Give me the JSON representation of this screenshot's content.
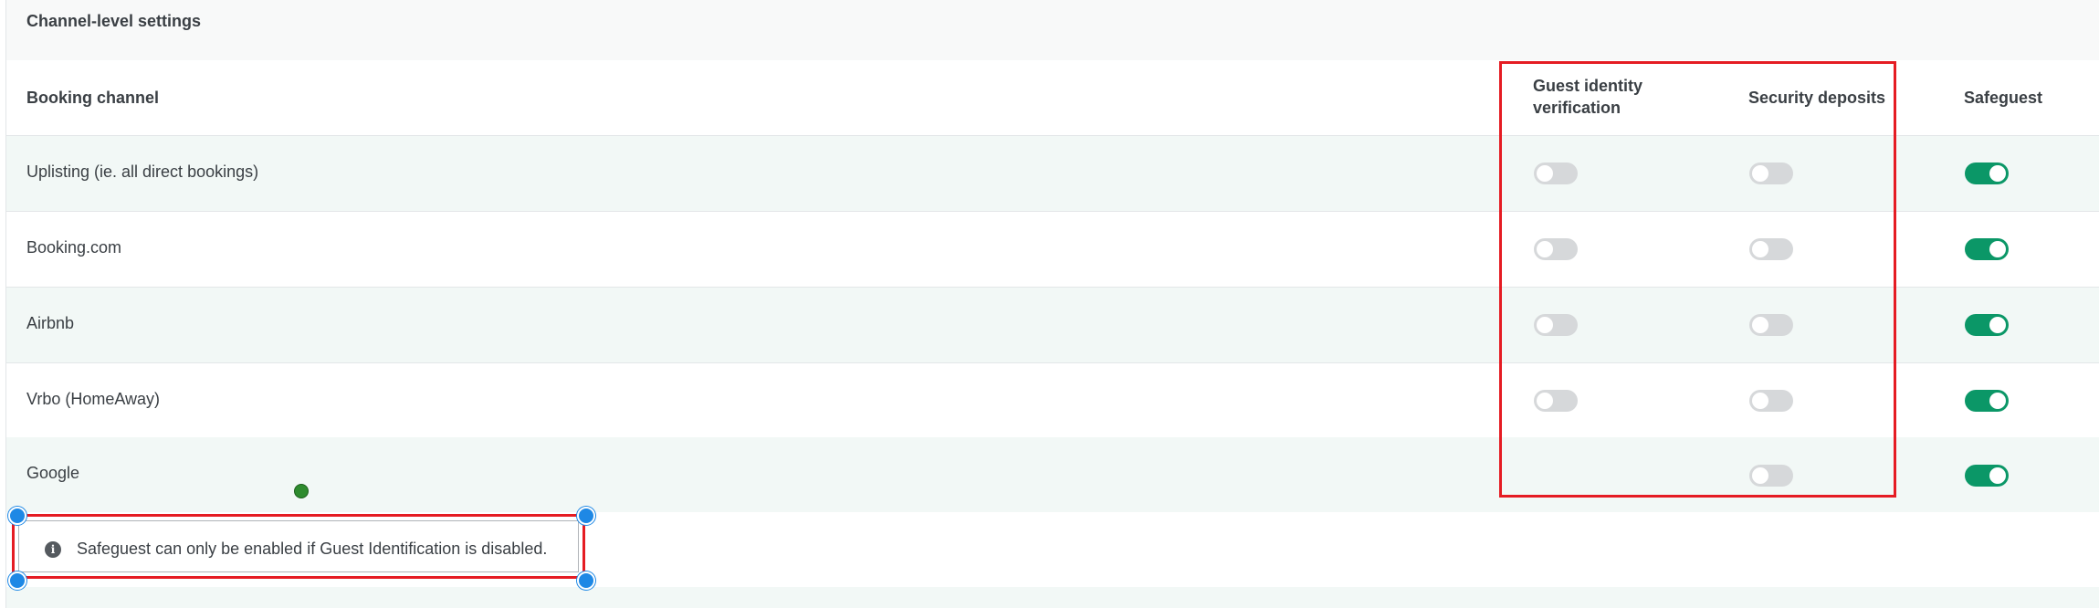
{
  "section": {
    "title": "Channel-level settings"
  },
  "table": {
    "headers": {
      "channel": "Booking channel",
      "guest_id_line1": "Guest identity",
      "guest_id_line2": "verification",
      "deposits": "Security deposits",
      "safeguest": "Safeguest"
    },
    "rows": [
      {
        "channel": "Uplisting (ie. all direct bookings)",
        "guest_identity_verification": "off",
        "security_deposits": "off",
        "safeguest": "on"
      },
      {
        "channel": "Booking.com",
        "guest_identity_verification": "off",
        "security_deposits": "off",
        "safeguest": "on"
      },
      {
        "channel": "Airbnb",
        "guest_identity_verification": "off",
        "security_deposits": "off",
        "safeguest": "on"
      },
      {
        "channel": "Vrbo (HomeAway)",
        "guest_identity_verification": "off",
        "security_deposits": "off",
        "safeguest": "on"
      },
      {
        "channel": "Google",
        "guest_identity_verification": null,
        "security_deposits": "off",
        "safeguest": "on"
      }
    ]
  },
  "note": {
    "icon": "info-icon",
    "text": "Safeguest can only be enabled if Guest Identification is disabled."
  },
  "colors": {
    "toggle_on": "#0b9767",
    "toggle_off": "#d6d8da",
    "annotation_red": "#e51c23",
    "selection_handle": "#1e88e5"
  }
}
